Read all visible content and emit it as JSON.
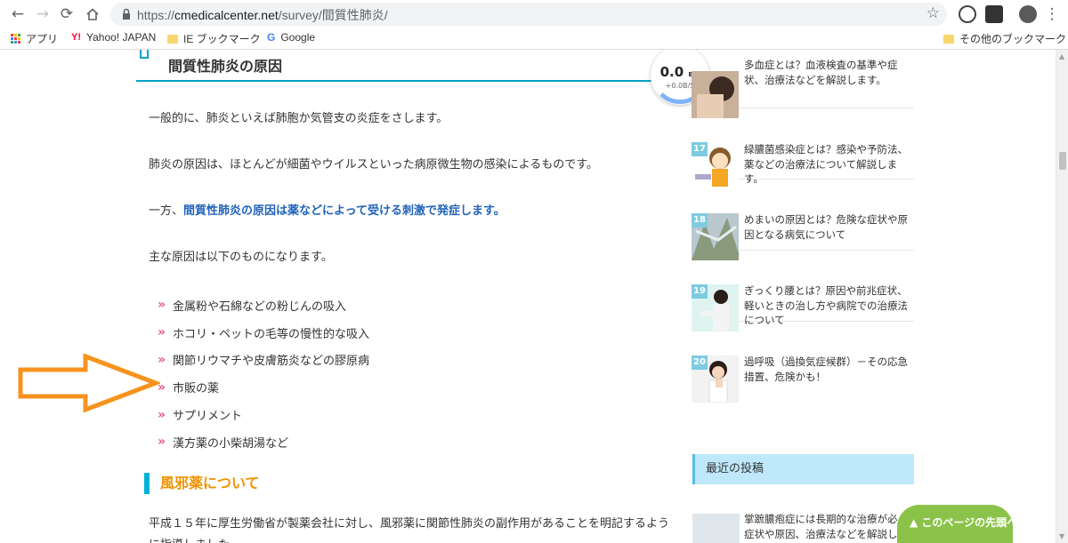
{
  "browser": {
    "url_scheme": "https://",
    "url_host": "cmedicalcenter.net",
    "url_path": "/survey/間質性肺炎/",
    "bookmarks": [
      {
        "label": "アプリ"
      },
      {
        "label": "Yahoo! JAPAN"
      },
      {
        "label": "IE ブックマーク"
      },
      {
        "label": "Google"
      }
    ],
    "other_bookmarks": "その他のブックマーク"
  },
  "article": {
    "heading": "間質性肺炎の原因",
    "p1": "一般的に、肺炎といえば肺胞か気管支の炎症をさします。",
    "p2": "肺炎の原因は、ほとんどが細菌やウイルスといった病原微生物の感染によるものです。",
    "p3_prefix": "一方、",
    "p3_highlight": "間質性肺炎の原因は薬などによって受ける刺激で発症します。",
    "p4": "主な原因は以下のものになります。",
    "causes": [
      "金属粉や石綿などの粉じんの吸入",
      "ホコリ・ペットの毛等の慢性的な吸入",
      "関節リウマチや皮膚筋炎などの膠原病",
      "市販の薬",
      "サプリメント",
      "漢方薬の小柴胡湯など"
    ],
    "list_marker": "»",
    "subheading": "風邪薬について",
    "p5": "平成１５年に厚生労働省が製薬会社に対し、風邪薬に関節性肺炎の副作用があることを明記するよう",
    "p6": "に指導しました。"
  },
  "speed_widget": {
    "value": "0.0",
    "unit": "B/S",
    "delta": "+0.0B/S"
  },
  "sidebar": {
    "ranking": [
      {
        "rank": "",
        "title": "多血症とは？血液検査の基準や症\n状、治療法などを解説します。"
      },
      {
        "rank": "17",
        "title": "緑膿菌感染症とは？感染や予防法、\n薬などの治療法について解説しま\nす。"
      },
      {
        "rank": "18",
        "title": "めまいの原因とは？危険な症状や原\n因となる病気について"
      },
      {
        "rank": "19",
        "title": "ぎっくり腰とは？原因や前兆症状、\n軽いときの治し方や病院での治療法\nについて"
      },
      {
        "rank": "20",
        "title": "過呼吸（過換気症候群）－その応急\n措置、危険かも！"
      }
    ],
    "recent_heading": "最近の投稿",
    "recent_item": "掌蹠膿疱症には長期的な治療が必\n症状や原因、治療法などを解説し"
  },
  "back_to_top": "▲ このページの先頭へ",
  "colors": {
    "accent_blue": "#00a2c9",
    "highlight_text": "#2163b8",
    "list_marker": "#e8598c",
    "subheading_text": "#f39200",
    "arrow_orange": "#f7931e",
    "back_to_top_bg": "#8bc34a"
  }
}
